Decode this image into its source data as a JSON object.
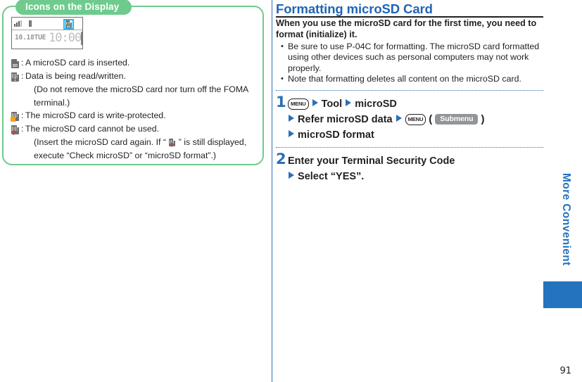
{
  "left_panel": {
    "tab_label": "Icons on the Display",
    "phone_display": {
      "date": "10.18TUE",
      "time": "10:00",
      "highlighted_icon": "microsd-inserted-icon",
      "status_icons": [
        "signal-bars-icon",
        "battery-icon",
        "microsd-card-icon"
      ]
    },
    "legend": [
      {
        "icon": "microsd-inserted-icon",
        "colon": ":",
        "text": "A microSD card is inserted.",
        "sub": []
      },
      {
        "icon": "microsd-readwrite-icon",
        "colon": ":",
        "text": "Data is being read/written.",
        "sub": [
          "(Do not remove the microSD card nor turn off the FOMA",
          "terminal.)"
        ]
      },
      {
        "icon": "microsd-write-protected-icon",
        "colon": ":",
        "text": "The microSD card is write-protected.",
        "sub": []
      },
      {
        "icon": "microsd-unusable-icon",
        "colon": ":",
        "text": "The microSD card cannot be used.",
        "sub": [],
        "sub_parts": {
          "before": "(Insert the microSD card again. If “",
          "after": "” is still displayed,",
          "line2": "execute “Check microSD” or “microSD format”.)"
        }
      }
    ]
  },
  "right_column": {
    "heading": "Formatting microSD Card",
    "intro": "When you use the microSD card for the first time, you need to format (initialize) it.",
    "notes": [
      "Be sure to use P-04C for formatting. The microSD card formatted using other devices such as personal computers may not work properly.",
      "Note that formatting deletes all content on the microSD card."
    ],
    "steps": [
      {
        "number": "1",
        "lines": [
          {
            "key": "MENU",
            "items": [
              "Tool",
              "microSD"
            ]
          },
          {
            "items": [
              "Refer microSD data"
            ],
            "key_after": "MENU",
            "softkey": "Submenu"
          },
          {
            "items": [
              "microSD format"
            ]
          }
        ]
      },
      {
        "number": "2",
        "lines": [
          {
            "plain": "Enter your Terminal Security Code"
          },
          {
            "items": [
              "Select “YES”."
            ]
          }
        ]
      }
    ]
  },
  "side_tab": {
    "label": "More Convenient",
    "color": "#2473BE"
  },
  "footer": {
    "page_number": "91"
  },
  "colors": {
    "panel_green": "#6ECB8D",
    "heading_blue": "#1F66B5",
    "arrow_blue": "#2C6FB5",
    "highlight_cyan": "#22B9E8",
    "softkey_gray": "#939598",
    "lock_orange": "#F5A11C",
    "question_red": "#E03A27"
  }
}
